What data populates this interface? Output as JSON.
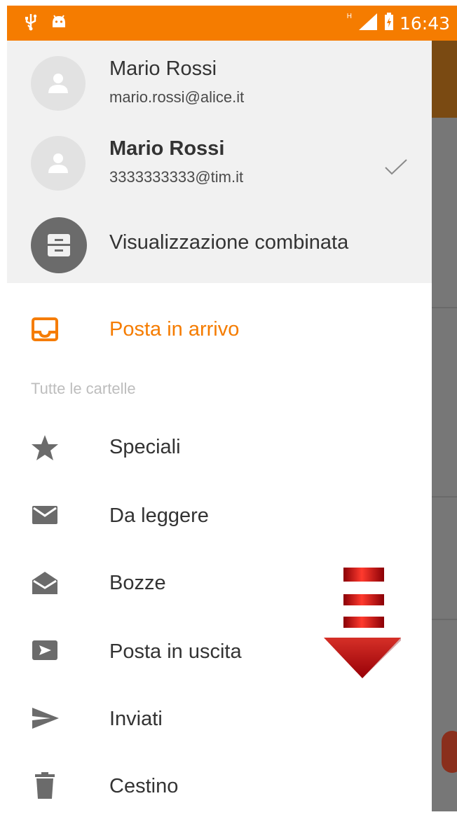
{
  "status_bar": {
    "time": "16:43",
    "network_label": "H",
    "icons": [
      "usb-icon",
      "android-icon",
      "signal-icon",
      "battery-icon"
    ]
  },
  "accounts": [
    {
      "name": "Mario Rossi",
      "email": "mario.rossi@alice.it",
      "selected": false
    },
    {
      "name": "Mario Rossi",
      "email": "3333333333@tim.it",
      "selected": true
    }
  ],
  "combined_view": {
    "label": "Visualizzazione combinata",
    "icon": "archive-icon"
  },
  "inbox": {
    "label": "Posta in arrivo",
    "icon": "inbox-icon"
  },
  "section_label": "Tutte le cartelle",
  "folders": [
    {
      "label": "Speciali",
      "icon": "star-icon"
    },
    {
      "label": "Da leggere",
      "icon": "mail-icon"
    },
    {
      "label": "Bozze",
      "icon": "drafts-icon"
    },
    {
      "label": "Posta in uscita",
      "icon": "outbox-icon"
    },
    {
      "label": "Inviati",
      "icon": "send-icon"
    },
    {
      "label": "Cestino",
      "icon": "trash-icon"
    }
  ],
  "colors": {
    "accent": "#f57c00",
    "account_header_bg": "#f1f1f1",
    "icon_gray": "#6b6b6b",
    "arrow_red": "#c8000a"
  }
}
